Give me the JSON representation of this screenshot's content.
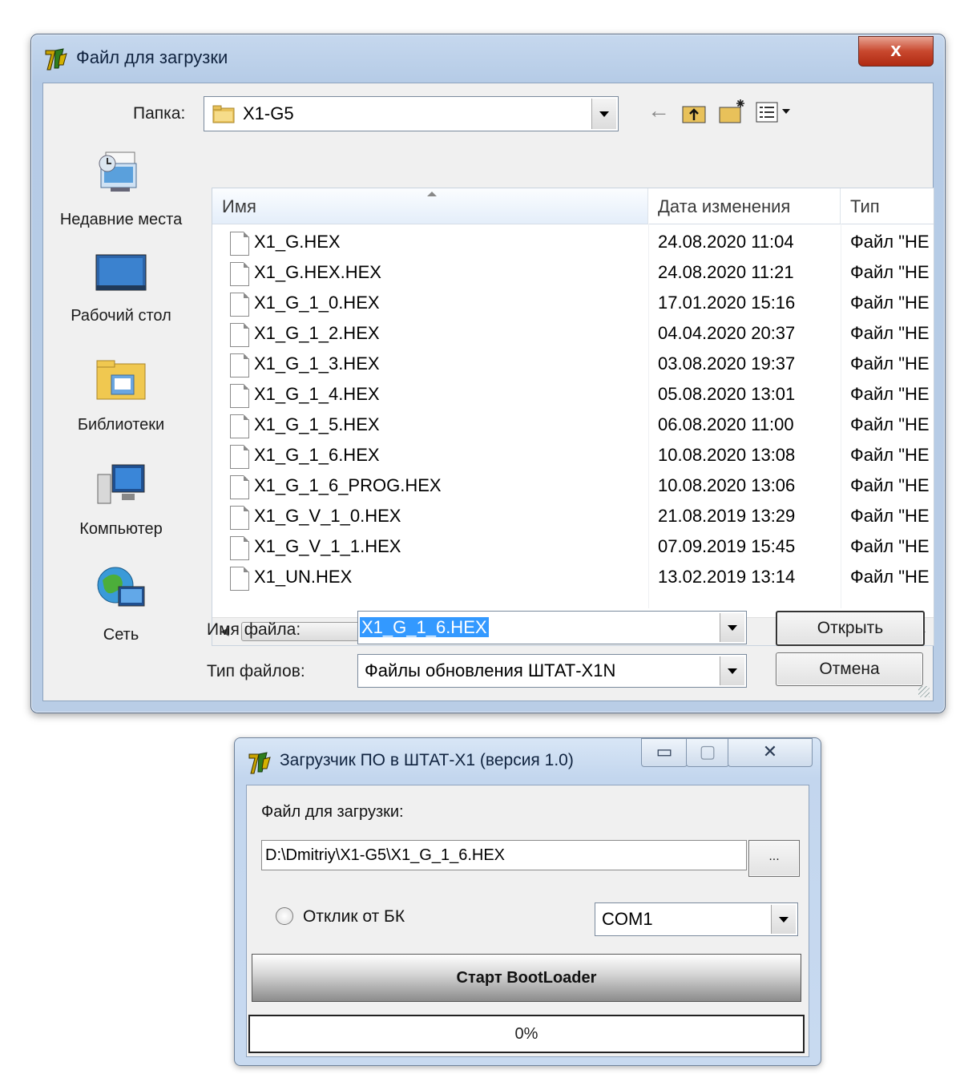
{
  "dialog": {
    "title": "Файл для загрузки",
    "close_label": "x",
    "folder_label": "Папка:",
    "folder_value": "X1-G5",
    "toolbar": {
      "back_icon": "←",
      "up_icon": "⤒",
      "newfolder_icon": "✱",
      "views_icon": "▦"
    },
    "places": [
      {
        "label": "Недавние места"
      },
      {
        "label": "Рабочий стол"
      },
      {
        "label": "Библиотеки"
      },
      {
        "label": "Компьютер"
      },
      {
        "label": "Сеть"
      }
    ],
    "columns": {
      "name": "Имя",
      "date": "Дата изменения",
      "type": "Тип"
    },
    "files": [
      {
        "name": "X1_G.HEX",
        "date": "24.08.2020 11:04",
        "type": "Файл \"HE"
      },
      {
        "name": "X1_G.HEX.HEX",
        "date": "24.08.2020 11:21",
        "type": "Файл \"HE"
      },
      {
        "name": "X1_G_1_0.HEX",
        "date": "17.01.2020 15:16",
        "type": "Файл \"HE"
      },
      {
        "name": "X1_G_1_2.HEX",
        "date": "04.04.2020 20:37",
        "type": "Файл \"HE"
      },
      {
        "name": "X1_G_1_3.HEX",
        "date": "03.08.2020 19:37",
        "type": "Файл \"HE"
      },
      {
        "name": "X1_G_1_4.HEX",
        "date": "05.08.2020 13:01",
        "type": "Файл \"HE"
      },
      {
        "name": "X1_G_1_5.HEX",
        "date": "06.08.2020 11:00",
        "type": "Файл \"HE"
      },
      {
        "name": "X1_G_1_6.HEX",
        "date": "10.08.2020 13:08",
        "type": "Файл \"HE"
      },
      {
        "name": "X1_G_1_6_PROG.HEX",
        "date": "10.08.2020 13:06",
        "type": "Файл \"HE"
      },
      {
        "name": "X1_G_V_1_0.HEX",
        "date": "21.08.2019 13:29",
        "type": "Файл \"HE"
      },
      {
        "name": "X1_G_V_1_1.HEX",
        "date": "07.09.2019 15:45",
        "type": "Файл \"HE"
      },
      {
        "name": "X1_UN.HEX",
        "date": "13.02.2019 13:14",
        "type": "Файл \"HE"
      }
    ],
    "scroll_thumb_label": "III",
    "filename_label": "Имя файла:",
    "filename_value": "X1_G_1_6.HEX",
    "filetype_label": "Тип файлов:",
    "filetype_value": "Файлы обновления ШТАТ-X1N",
    "open_label": "Открыть",
    "cancel_label": "Отмена"
  },
  "loader": {
    "title": "Загрузчик ПО в ШТАТ-X1 (версия 1.0)",
    "minimize_label": "▭",
    "maximize_label": "▢",
    "close_label": "✕",
    "file_label": "Файл для загрузки:",
    "file_path": "D:\\Dmitriy\\X1-G5\\X1_G_1_6.HEX",
    "browse_label": "...",
    "radio_label": "Отклик от БК",
    "port_value": "COM1",
    "start_label": "Старт BootLoader",
    "progress_text": "0%",
    "progress_value": 0
  },
  "colors": {
    "selection": "#3399ff",
    "frame": "#b9cde6",
    "close": "#c8482e"
  }
}
